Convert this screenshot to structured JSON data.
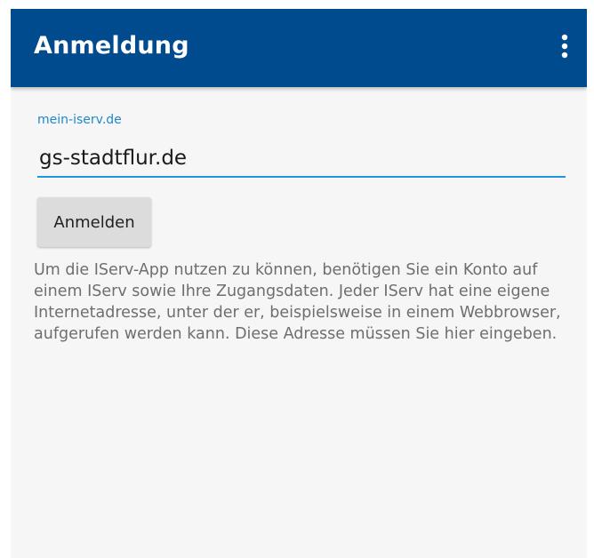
{
  "appbar": {
    "title": "Anmeldung",
    "menu_icon": "more-vert-icon"
  },
  "form": {
    "field_label": "mein-iserv.de",
    "field_value": "gs-stadtflur.de",
    "submit_label": "Anmelden"
  },
  "help_text": "Um die IServ-App nutzen zu können, benötigen Sie ein Konto auf einem IServ sowie Ihre Zugangsdaten. Jeder IServ hat eine eigene Internetadresse, unter der er, beispielsweise in einem Webbrowser, aufgerufen werden kann. Diese Adresse müssen Sie hier eingeben.",
  "colors": {
    "appbar": "#004b8d",
    "accent": "#2196e0",
    "label": "#1e88c8",
    "background": "#f6f6f6",
    "button": "#dcdcdc"
  }
}
